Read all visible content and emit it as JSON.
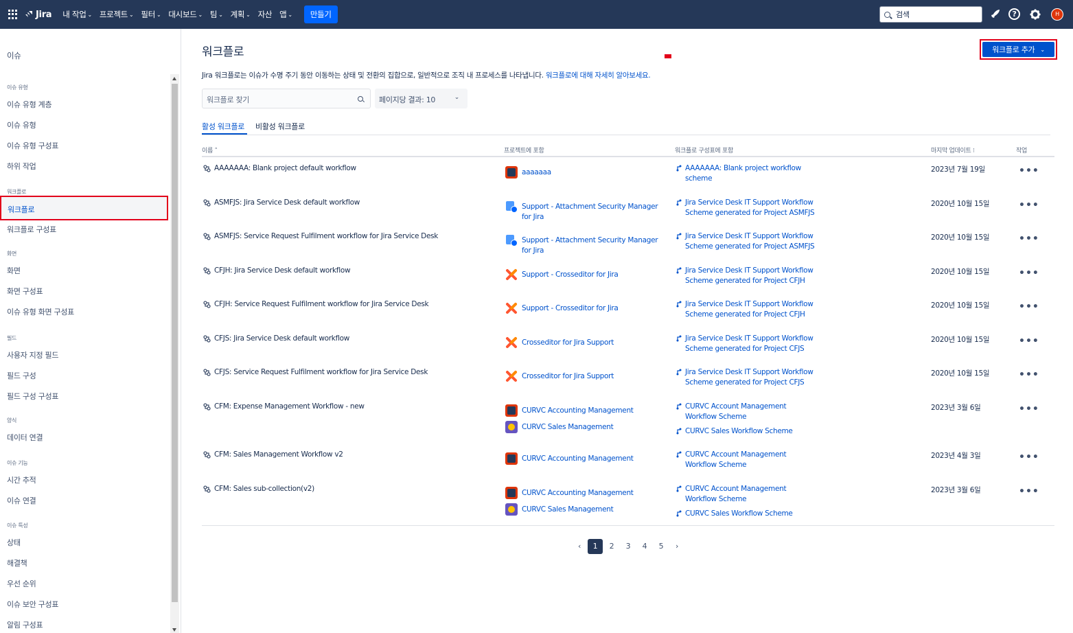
{
  "topnav": {
    "brand": "Jira",
    "items": [
      {
        "label": "내 작업",
        "chev": "⌄"
      },
      {
        "label": "프로젝트",
        "chev": "⌄"
      },
      {
        "label": "필터",
        "chev": "⌄"
      },
      {
        "label": "대시보드",
        "chev": "⌄"
      },
      {
        "label": "팀",
        "chev": "⌄"
      },
      {
        "label": "계획",
        "chev": "⌄"
      },
      {
        "label": "자산",
        "chev": ""
      },
      {
        "label": "앱",
        "chev": "⌄"
      }
    ],
    "create_label": "만들기",
    "search_placeholder": "검색",
    "avatar_initial": "H"
  },
  "sidebar": {
    "title": "이슈",
    "sections": [
      {
        "label": "이슈 유형",
        "items": [
          "이슈 유형 계층",
          "이슈 유형",
          "이슈 유형 구성표",
          "하위 작업"
        ]
      },
      {
        "label": "워크플로",
        "items": [
          "워크플로",
          "워크플로 구성표"
        ]
      },
      {
        "label": "화면",
        "items": [
          "화면",
          "화면 구성표",
          "이슈 유형 화면 구성표"
        ]
      },
      {
        "label": "필드",
        "items": [
          "사용자 지정 필드",
          "필드 구성",
          "필드 구성 구성표"
        ]
      },
      {
        "label": "양식",
        "items": [
          "데이터 연결"
        ]
      },
      {
        "label": "이슈 기능",
        "items": [
          "시간 추적",
          "이슈 연결"
        ]
      },
      {
        "label": "이슈 특성",
        "items": [
          "상태",
          "해결책",
          "우선 순위",
          "이슈 보안 구성표",
          "알림 구성표"
        ]
      }
    ],
    "active_item": "워크플로"
  },
  "main": {
    "title": "워크플로",
    "add_button": "워크플로 추가",
    "description": "Jira 워크플로는 이슈가 수명 주기 동안 이동하는 상태 및 전환의 집합으로, 일반적으로 조직 내 프로세스를 나타냅니다. ",
    "description_link": "워크플로에 대해 자세히 알아보세요.",
    "search_placeholder": "워크플로 찾기",
    "per_page": "페이지당 결과: 10",
    "tabs": [
      "활성 워크플로",
      "비활성 워크플로"
    ],
    "columns": [
      "이름",
      "프로젝트에 포함",
      "워크플로 구성표에 포함",
      "마지막 업데이트",
      "작업"
    ],
    "sort_marks": {
      "name": "˄",
      "updated": "⁝"
    },
    "rows": [
      {
        "name": "AAAAAAA: Blank project default workflow",
        "projects": [
          {
            "name": "aaaaaaa",
            "icon": "dark"
          }
        ],
        "schemes": [
          "AAAAAAA: Blank project workflow scheme"
        ],
        "updated": "2023년 7월 19일"
      },
      {
        "name": "ASMFJS: Jira Service Desk default workflow",
        "projects": [
          {
            "name": "Support - Attachment Security Manager for Jira",
            "icon": "blue"
          }
        ],
        "schemes": [
          "Jira Service Desk IT Support Workflow Scheme generated for Project ASMFJS"
        ],
        "updated": "2020년 10월 15일"
      },
      {
        "name": "ASMFJS: Service Request Fulfilment workflow for Jira Service Desk",
        "projects": [
          {
            "name": "Support - Attachment Security Manager for Jira",
            "icon": "blue"
          }
        ],
        "schemes": [
          "Jira Service Desk IT Support Workflow Scheme generated for Project ASMFJS"
        ],
        "updated": "2020년 10월 15일"
      },
      {
        "name": "CFJH: Jira Service Desk default workflow",
        "projects": [
          {
            "name": "Support - Crosseditor for Jira",
            "icon": "x"
          }
        ],
        "schemes": [
          "Jira Service Desk IT Support Workflow Scheme generated for Project CFJH"
        ],
        "updated": "2020년 10월 15일"
      },
      {
        "name": "CFJH: Service Request Fulfilment workflow for Jira Service Desk",
        "projects": [
          {
            "name": "Support - Crosseditor for Jira",
            "icon": "x"
          }
        ],
        "schemes": [
          "Jira Service Desk IT Support Workflow Scheme generated for Project CFJH"
        ],
        "updated": "2020년 10월 15일"
      },
      {
        "name": "CFJS: Jira Service Desk default workflow",
        "projects": [
          {
            "name": "Crosseditor for Jira Support",
            "icon": "x"
          }
        ],
        "schemes": [
          "Jira Service Desk IT Support Workflow Scheme generated for Project CFJS"
        ],
        "updated": "2020년 10월 15일"
      },
      {
        "name": "CFJS: Service Request Fulfilment workflow for Jira Service Desk",
        "projects": [
          {
            "name": "Crosseditor for Jira Support",
            "icon": "x"
          }
        ],
        "schemes": [
          "Jira Service Desk IT Support Workflow Scheme generated for Project CFJS"
        ],
        "updated": "2020년 10월 15일"
      },
      {
        "name": "CFM: Expense Management Workflow - new",
        "projects": [
          {
            "name": "CURVC Accounting Management",
            "icon": "dark"
          },
          {
            "name": "CURVC Sales Management",
            "icon": "purple"
          }
        ],
        "schemes": [
          "CURVC Account Management Workflow Scheme",
          "CURVC Sales Workflow Scheme"
        ],
        "updated": "2023년 3월 6일"
      },
      {
        "name": "CFM: Sales Management Workflow v2",
        "projects": [
          {
            "name": "CURVC Accounting Management",
            "icon": "dark"
          }
        ],
        "schemes": [
          "CURVC Account Management Workflow Scheme"
        ],
        "updated": "2023년 4월 3일"
      },
      {
        "name": "CFM: Sales sub-collection(v2)",
        "projects": [
          {
            "name": "CURVC Accounting Management",
            "icon": "dark"
          },
          {
            "name": "CURVC Sales Management",
            "icon": "purple"
          }
        ],
        "schemes": [
          "CURVC Account Management Workflow Scheme",
          "CURVC Sales Workflow Scheme"
        ],
        "updated": "2023년 3월 6일"
      }
    ],
    "row_action": "•••",
    "pagination": {
      "prev": "‹",
      "pages": [
        "1",
        "2",
        "3",
        "4",
        "5"
      ],
      "current": "1",
      "next": "›"
    }
  },
  "colors": {
    "nav": "#253858",
    "link": "#0052cc",
    "primary": "#0052cc",
    "highlight": "#e2001a"
  }
}
